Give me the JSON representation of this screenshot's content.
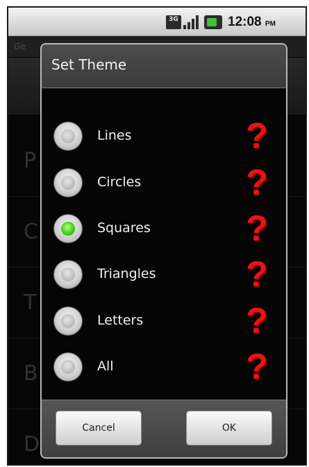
{
  "status_bar": {
    "network_label": "3G",
    "time": "12:08",
    "time_suffix": "PM",
    "battery_color": "#3fbf3f"
  },
  "background_app": {
    "title": "Ge",
    "rows": [
      "P",
      "C",
      "T",
      "B",
      "D"
    ]
  },
  "dialog": {
    "title": "Set Theme",
    "options": [
      {
        "label": "Lines",
        "checked": false,
        "icon": "question-mark-icon"
      },
      {
        "label": "Circles",
        "checked": false,
        "icon": "question-mark-icon"
      },
      {
        "label": "Squares",
        "checked": true,
        "icon": "question-mark-icon"
      },
      {
        "label": "Triangles",
        "checked": false,
        "icon": "question-mark-icon"
      },
      {
        "label": "Letters",
        "checked": false,
        "icon": "question-mark-icon"
      },
      {
        "label": "All",
        "checked": false,
        "icon": "question-mark-icon"
      }
    ],
    "question_glyph": "?",
    "question_color": "#e81414",
    "selected_color": "#3ed11a",
    "buttons": {
      "cancel": "Cancel",
      "ok": "OK"
    }
  }
}
